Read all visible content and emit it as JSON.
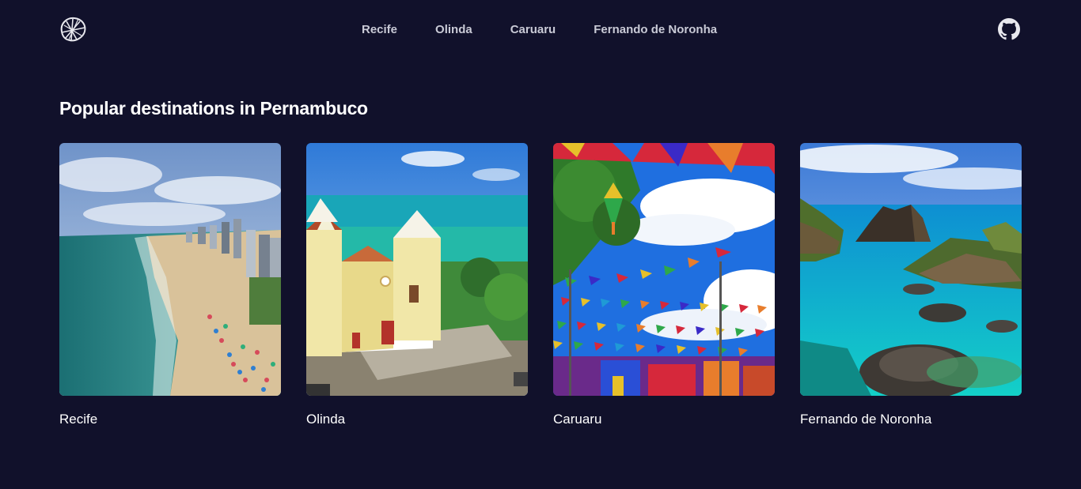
{
  "header": {
    "logo_icon": "decorative-shell-logo-icon",
    "nav": [
      {
        "label": "Recife"
      },
      {
        "label": "Olinda"
      },
      {
        "label": "Caruaru"
      },
      {
        "label": "Fernando de Noronha"
      }
    ],
    "github_icon": "github-icon"
  },
  "main": {
    "title": "Popular destinations in Pernambuco",
    "cards": [
      {
        "name": "Recife",
        "image": "beach-with-city-skyline-photo"
      },
      {
        "name": "Olinda",
        "image": "colonial-church-by-the-sea-photo"
      },
      {
        "name": "Caruaru",
        "image": "festival-flags-and-lantern-photo"
      },
      {
        "name": "Fernando de Noronha",
        "image": "island-rock-formations-photo"
      }
    ]
  },
  "colors": {
    "background": "#11112b",
    "nav_text": "#c9cad6",
    "text": "#ffffff"
  }
}
